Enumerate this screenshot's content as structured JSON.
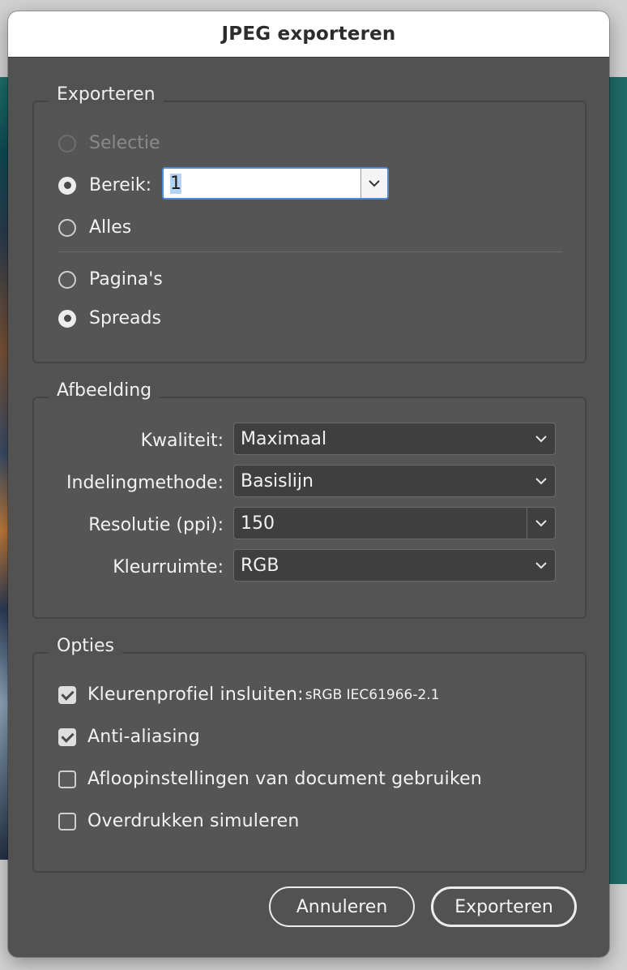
{
  "dialog": {
    "title": "JPEG exporteren"
  },
  "export": {
    "legend": "Exporteren",
    "selection_label": "Selectie",
    "range_label": "Bereik:",
    "range_value": "1",
    "all_label": "Alles",
    "pages_label": "Pagina's",
    "spreads_label": "Spreads"
  },
  "image": {
    "legend": "Afbeelding",
    "quality_label": "Kwaliteit:",
    "quality_value": "Maximaal",
    "format_method_label": "Indelingmethode:",
    "format_method_value": "Basislijn",
    "resolution_label": "Resolutie (ppi):",
    "resolution_value": "150",
    "color_space_label": "Kleurruimte:",
    "color_space_value": "RGB"
  },
  "options": {
    "legend": "Opties",
    "embed_profile_label": "Kleurenprofiel insluiten:",
    "embed_profile_value": "sRGB IEC61966-2.1",
    "anti_aliasing_label": "Anti-aliasing",
    "bleed_label": "Afloopinstellingen van document gebruiken",
    "overprint_label": "Overdrukken simuleren"
  },
  "buttons": {
    "cancel": "Annuleren",
    "export": "Exporteren"
  },
  "colors": {
    "dialog_bg": "#525252",
    "focus_ring": "#4f8cd9",
    "titlebar": "#ffffff"
  }
}
